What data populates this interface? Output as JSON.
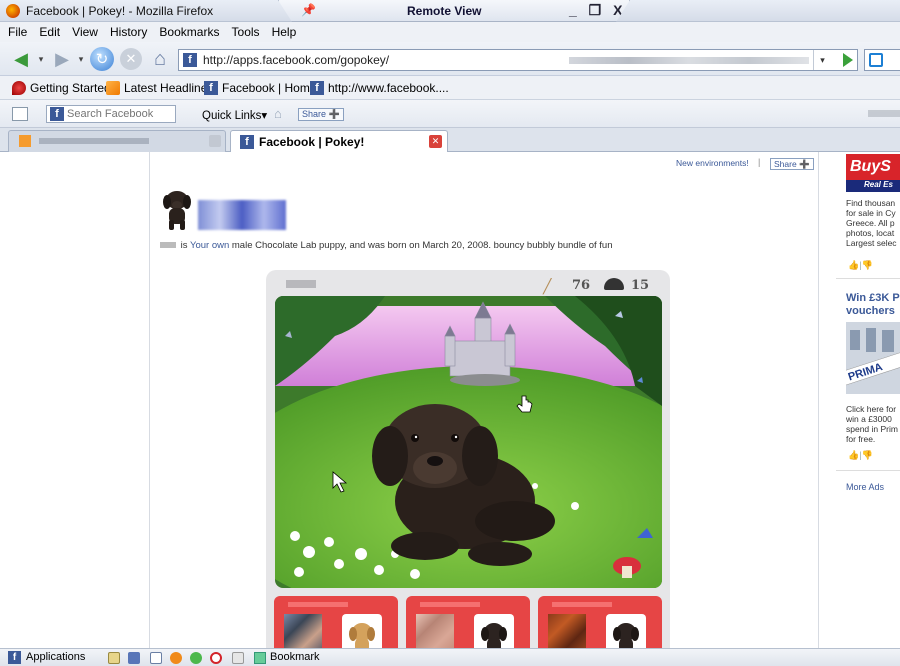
{
  "window": {
    "title": "Facebook | Pokey! - Mozilla Firefox",
    "remote_title": "Remote View",
    "remote_controls": "_ ❐ X"
  },
  "menu": [
    "File",
    "Edit",
    "View",
    "History",
    "Bookmarks",
    "Tools",
    "Help"
  ],
  "nav": {
    "url": "http://apps.facebook.com/gopokey/"
  },
  "bookmarks": [
    {
      "label": "Getting Started",
      "icon": "getting-started-icon"
    },
    {
      "label": "Latest Headlines",
      "icon": "rss-icon"
    },
    {
      "label": "Facebook | Home",
      "icon": "facebook-icon"
    },
    {
      "label": "http://www.facebook....",
      "icon": "facebook-icon"
    }
  ],
  "fb_toolbar": {
    "search_placeholder": "Search Facebook",
    "quick_links": "Quick Links▾",
    "share": "Share"
  },
  "tabs": {
    "active_label": "Facebook | Pokey!"
  },
  "page": {
    "new_env": "New environments!",
    "separator": "|",
    "share": "Share",
    "desc_is": "is",
    "desc_link": "Your own",
    "desc_rest": "male Chocolate Lab puppy, and was born on March 20, 2008. bouncy bubbly bundle of fun",
    "bones": "76",
    "food": "15"
  },
  "ads": {
    "ad1_brand": "BuyS",
    "ad1_sub": "Real Es",
    "ad1_lines": [
      "Find thousan",
      "for sale in Cy",
      "Greece. All p",
      "photos, locat",
      "Largest selec"
    ],
    "ad2_head": [
      "Win £3K P",
      "vouchers"
    ],
    "ad2_img_text": "PRIMA",
    "ad2_lines": [
      "Click here for",
      "win a £3000",
      "spend in Prim",
      "for free."
    ],
    "more_ads": "More Ads"
  },
  "taskbar": {
    "applications": "Applications",
    "bookmark": "Bookmark"
  },
  "colors": {
    "facebook_blue": "#3b5998",
    "friend_box_red": "#e64545"
  }
}
